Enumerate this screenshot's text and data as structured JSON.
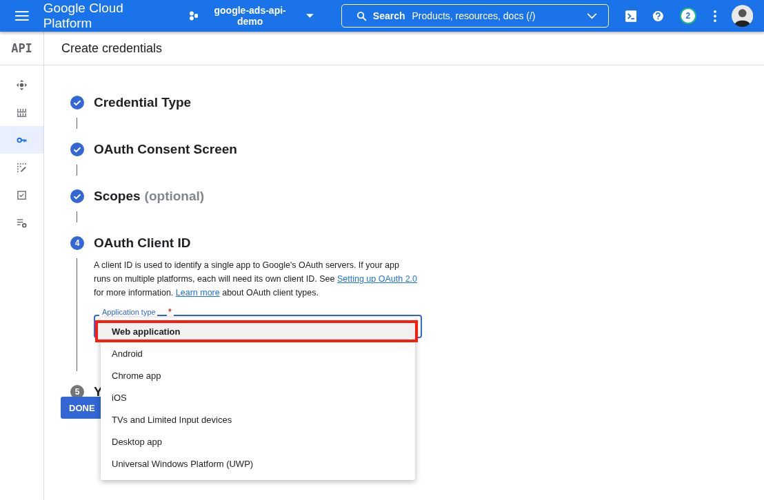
{
  "top_bar": {
    "title": "Google Cloud Platform",
    "project": "google-ads-api-demo",
    "search": {
      "label": "Search",
      "placeholder": "Products, resources, docs (/)"
    },
    "notifications": "2"
  },
  "sidebar": {
    "logo": "API",
    "items": [
      {
        "selected": false
      },
      {
        "selected": false
      },
      {
        "selected": true
      },
      {
        "selected": false
      },
      {
        "selected": false
      },
      {
        "selected": false
      }
    ]
  },
  "page_title": "Create credentials",
  "steps": [
    {
      "completed": true,
      "title": "Credential Type"
    },
    {
      "completed": true,
      "title": "OAuth Consent Screen"
    },
    {
      "completed": true,
      "title": "Scopes",
      "hint": "(optional)"
    },
    {
      "completed": false,
      "active": true,
      "number": "4",
      "title": "OAuth Client ID",
      "description": [
        {
          "kind": "text",
          "text": "A client ID is used to identify a single app to Google's OAuth servers. If your app runs on multiple platforms, each will need its own client ID. See "
        },
        {
          "kind": "link",
          "text": "Setting up OAuth 2.0"
        },
        {
          "kind": "text",
          "text": " for more information. "
        },
        {
          "kind": "link",
          "text": "Learn more"
        },
        {
          "kind": "text",
          "text": " about OAuth client types."
        }
      ],
      "field": {
        "label": "Application type",
        "required_mark": "*",
        "options": [
          {
            "label": "Web application",
            "selected": true,
            "highlighted": true
          },
          {
            "label": "Android",
            "selected": false,
            "highlighted": false
          },
          {
            "label": "Chrome app",
            "selected": false,
            "highlighted": false
          },
          {
            "label": "iOS",
            "selected": false,
            "highlighted": false
          },
          {
            "label": "TVs and Limited Input devices",
            "selected": false,
            "highlighted": false
          },
          {
            "label": "Desktop app",
            "selected": false,
            "highlighted": false
          },
          {
            "label": "Universal Windows Platform (UWP)",
            "selected": false,
            "highlighted": false
          }
        ]
      }
    },
    {
      "completed": false,
      "active": false,
      "number": "5",
      "title": "Y"
    }
  ],
  "done_button": "DONE"
}
